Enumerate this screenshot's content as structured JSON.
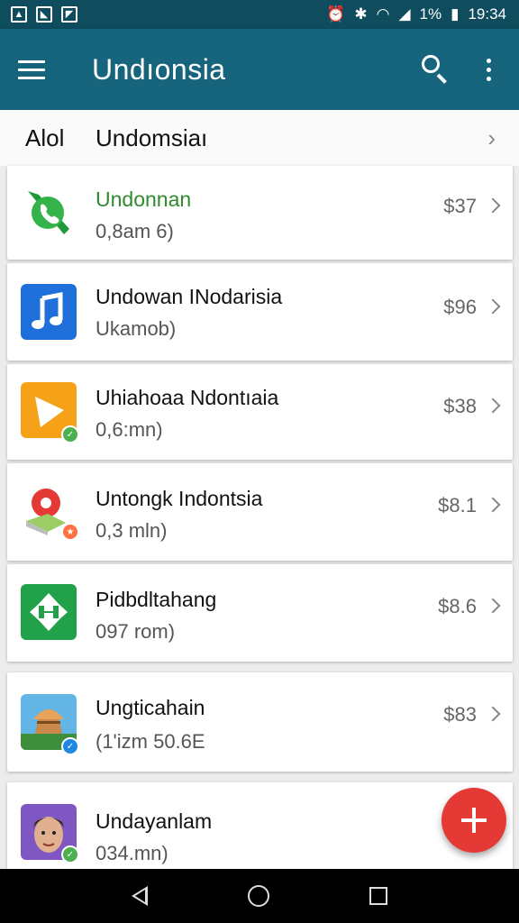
{
  "status_bar": {
    "battery": "1%",
    "time": "19:34"
  },
  "app_bar": {
    "title": "Undıonsia"
  },
  "subheader": {
    "left_label": "Alol",
    "title": "Undomsiaı"
  },
  "items": [
    {
      "name": "Undonnan",
      "meta": "0,8am 6)",
      "price": "$37",
      "icon": "phone-leaf-icon",
      "name_color": "#2e8b2e"
    },
    {
      "name": "Undowan INodarisia",
      "meta": "Ukamob)",
      "price": "$96",
      "icon": "music-note-icon"
    },
    {
      "name": "Uhiahoaa Ndontıaia",
      "meta": "0,6:mn)",
      "price": "$38",
      "icon": "play-icon"
    },
    {
      "name": "Untongk Indontsia",
      "meta": "0,3 mln)",
      "price": "$8.1",
      "icon": "map-icon"
    },
    {
      "name": "Pidbdltahang",
      "meta": "097 rom)",
      "price": "$8.6",
      "icon": "recycle-arrows-icon"
    },
    {
      "name": "Ungticahain",
      "meta": "(1'izm 50.6E",
      "price": "$83",
      "icon": "temple-icon"
    },
    {
      "name": "Undayanlam",
      "meta": "034.mn)",
      "price": "$",
      "icon": "avatar-icon"
    }
  ],
  "colors": {
    "status_bar": "#0e4c5e",
    "app_bar": "#17657c",
    "fab": "#e53935"
  }
}
